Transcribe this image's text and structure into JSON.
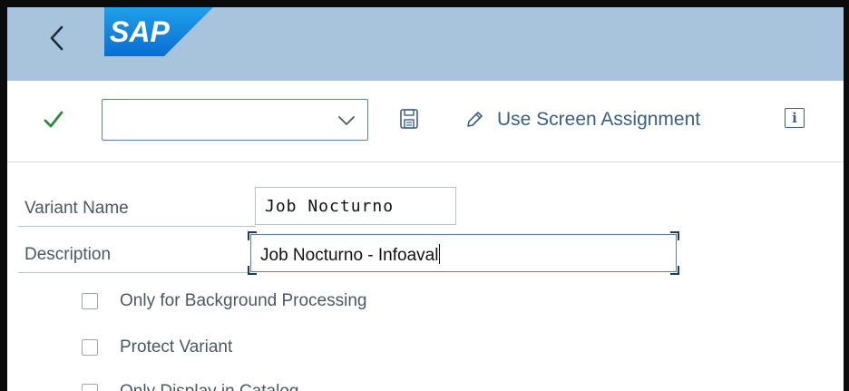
{
  "shell": {
    "logo_text": "SAP",
    "logo_color": "#0a6ed1"
  },
  "toolbar": {
    "variant_select_value": "",
    "save_icon": "save-icon",
    "assign_label": "Use Screen Assignment",
    "info_glyph": "i"
  },
  "form": {
    "variant_name_label": "Variant Name",
    "variant_name_value": "Job Nocturno",
    "description_label": "Description",
    "description_value": "Job Nocturno - Infoaval"
  },
  "checkboxes": [
    {
      "label": "Only for Background Processing",
      "checked": false
    },
    {
      "label": "Protect Variant",
      "checked": false
    },
    {
      "label": "Only Display in Catalog",
      "checked": false
    }
  ],
  "colors": {
    "shell_bg": "#a8c4dd",
    "accent": "#3a5f86",
    "check_green": "#2b8a3e"
  }
}
